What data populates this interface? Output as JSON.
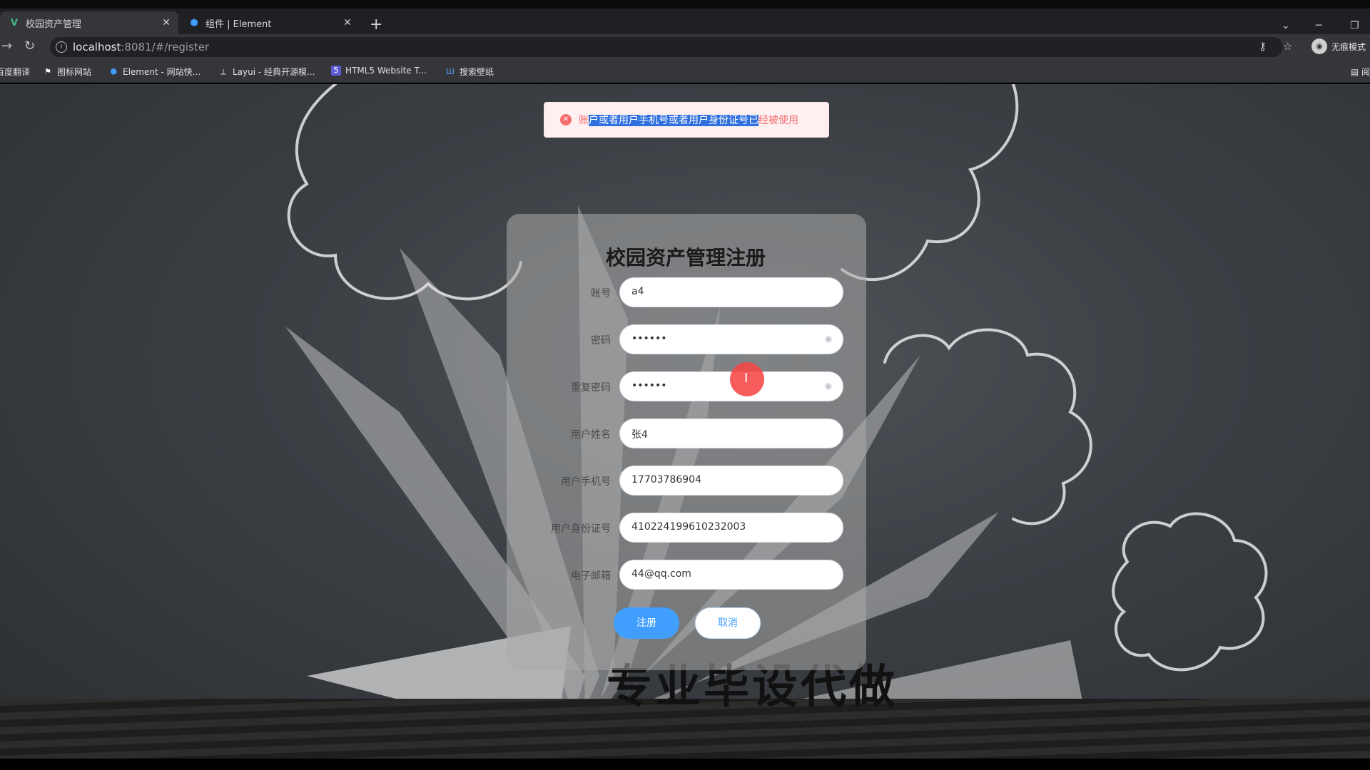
{
  "browser": {
    "tabs": [
      {
        "title": "校园资产管理",
        "icon": "vue-icon",
        "active": true
      },
      {
        "title": "组件 | Element",
        "icon": "element-icon",
        "active": false
      }
    ],
    "url_host": "localhost",
    "url_rest": ":8081/#/register",
    "profile_label": "无痕模式",
    "bookmarks": [
      {
        "label": "百度翻译",
        "icon": "translate-icon"
      },
      {
        "label": "图标网站",
        "icon": "flag-icon"
      },
      {
        "label": "Element - 网站快...",
        "icon": "element-icon"
      },
      {
        "label": "Layui - 经典开源模...",
        "icon": "layui-icon"
      },
      {
        "label": "HTML5 Website T...",
        "icon": "html5-icon"
      },
      {
        "label": "搜索壁纸",
        "icon": "wallpaper-icon"
      }
    ],
    "reader_label": "阅"
  },
  "message": {
    "type": "error",
    "prefix": "账",
    "highlighted": "户或者用户手机号或者用户身份证号已",
    "suffix": "经被使用",
    "color": "#f56c6c"
  },
  "form": {
    "title": "校园资产管理注册",
    "fields": [
      {
        "label": "账号",
        "value": "a4",
        "type": "text"
      },
      {
        "label": "密码",
        "value": "••••••",
        "type": "password"
      },
      {
        "label": "重复密码",
        "value": "••••••",
        "type": "password"
      },
      {
        "label": "用户姓名",
        "value": "张4",
        "type": "text"
      },
      {
        "label": "用户手机号",
        "value": "17703786904",
        "type": "text"
      },
      {
        "label": "用户身份证号",
        "value": "410224199610232003",
        "type": "text"
      },
      {
        "label": "电子邮箱",
        "value": "44@qq.com",
        "type": "text"
      }
    ],
    "register_label": "注册",
    "cancel_label": "取消",
    "primary_color": "#409eff"
  },
  "background": {
    "caption": "专业毕设代做"
  }
}
